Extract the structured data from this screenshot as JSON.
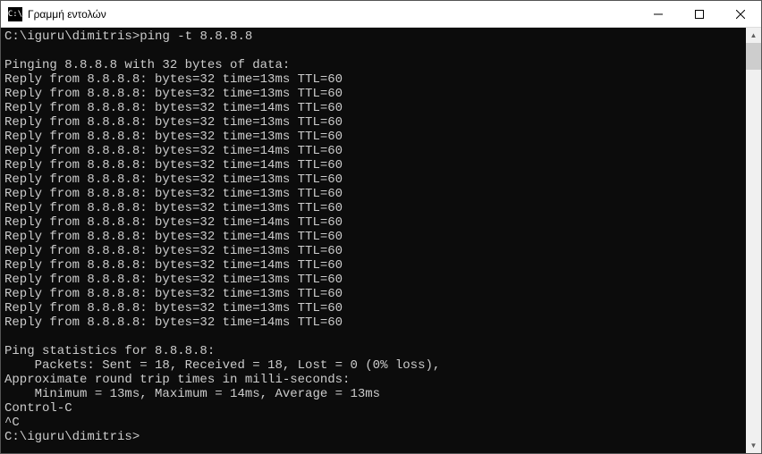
{
  "window": {
    "title": "Γραμμή εντολών",
    "icon_label": "C:\\"
  },
  "terminal": {
    "prompt_path": "C:\\iguru\\dimitris>",
    "command": "ping -t 8.8.8.8",
    "ping_header": "Pinging 8.8.8.8 with 32 bytes of data:",
    "replies": [
      "Reply from 8.8.8.8: bytes=32 time=13ms TTL=60",
      "Reply from 8.8.8.8: bytes=32 time=13ms TTL=60",
      "Reply from 8.8.8.8: bytes=32 time=14ms TTL=60",
      "Reply from 8.8.8.8: bytes=32 time=13ms TTL=60",
      "Reply from 8.8.8.8: bytes=32 time=13ms TTL=60",
      "Reply from 8.8.8.8: bytes=32 time=14ms TTL=60",
      "Reply from 8.8.8.8: bytes=32 time=14ms TTL=60",
      "Reply from 8.8.8.8: bytes=32 time=13ms TTL=60",
      "Reply from 8.8.8.8: bytes=32 time=13ms TTL=60",
      "Reply from 8.8.8.8: bytes=32 time=13ms TTL=60",
      "Reply from 8.8.8.8: bytes=32 time=14ms TTL=60",
      "Reply from 8.8.8.8: bytes=32 time=14ms TTL=60",
      "Reply from 8.8.8.8: bytes=32 time=13ms TTL=60",
      "Reply from 8.8.8.8: bytes=32 time=14ms TTL=60",
      "Reply from 8.8.8.8: bytes=32 time=13ms TTL=60",
      "Reply from 8.8.8.8: bytes=32 time=13ms TTL=60",
      "Reply from 8.8.8.8: bytes=32 time=13ms TTL=60",
      "Reply from 8.8.8.8: bytes=32 time=14ms TTL=60"
    ],
    "stats_header": "Ping statistics for 8.8.8.8:",
    "stats_packets": "    Packets: Sent = 18, Received = 18, Lost = 0 (0% loss),",
    "rtt_header": "Approximate round trip times in milli-seconds:",
    "rtt_values": "    Minimum = 13ms, Maximum = 14ms, Average = 13ms",
    "control_c": "Control-C",
    "caret_c": "^C",
    "final_prompt": "C:\\iguru\\dimitris>"
  }
}
